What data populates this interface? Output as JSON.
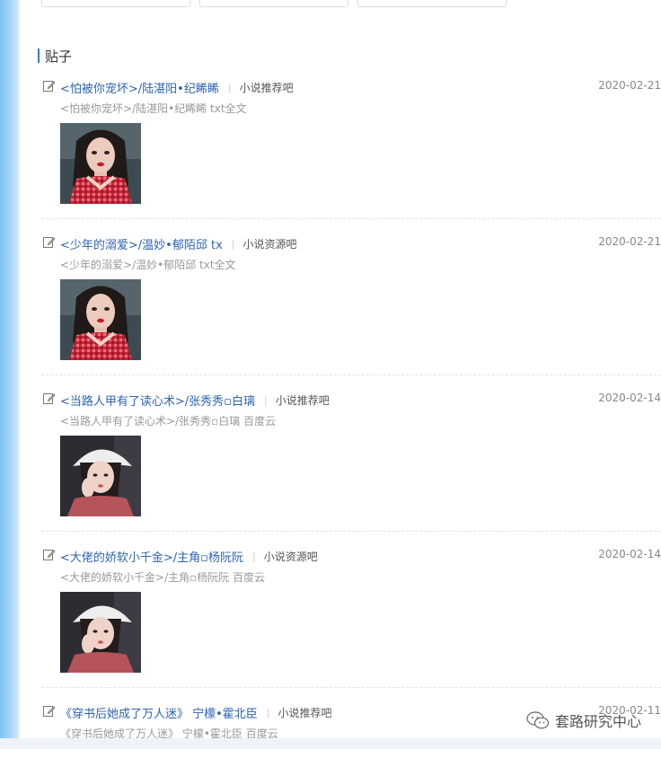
{
  "section": {
    "title": "贴子"
  },
  "posts": [
    {
      "title": "<怕被你宠坏>/陆湛阳•纪睎睎",
      "forum": "小说推荐吧",
      "date": "2020-02-21",
      "snippet": "<怕被你宠坏>/陆湛阳•纪睎睎 txt全文",
      "thumb": "girl-red-top"
    },
    {
      "title": "<少年的溺爱>/温妙•郁陌邱 tx",
      "forum": "小说资源吧",
      "date": "2020-02-21",
      "snippet": "<少年的溺爱>/温妙•郁陌邱 txt全文",
      "thumb": "girl-red-top"
    },
    {
      "title": "<当路人甲有了读心术>/张秀秀▫白璃",
      "forum": "小说推荐吧",
      "date": "2020-02-14",
      "snippet": "<当路人甲有了读心术>/张秀秀▫白璃 百度云",
      "thumb": "girl-white-cap"
    },
    {
      "title": "<大佬的娇软小千金>/主角▫杨阮阮",
      "forum": "小说资源吧",
      "date": "2020-02-14",
      "snippet": "<大佬的娇软小千金>/主角▫杨阮阮 百度云",
      "thumb": "girl-white-cap"
    },
    {
      "title": "《穿书后她成了万人迷》 宁檬•霍北臣",
      "forum": "小说推荐吧",
      "date": "2020-02-11",
      "snippet": "《穿书后她成了万人迷》 宁檬•霍北臣 百度云",
      "thumb": ""
    }
  ],
  "watermark": {
    "text": "套路研究中心",
    "icon": "wechat-icon"
  },
  "colors": {
    "link": "#2d64b3",
    "accent_bar": "#3b7ac7",
    "rail": "#7cc2ef"
  }
}
